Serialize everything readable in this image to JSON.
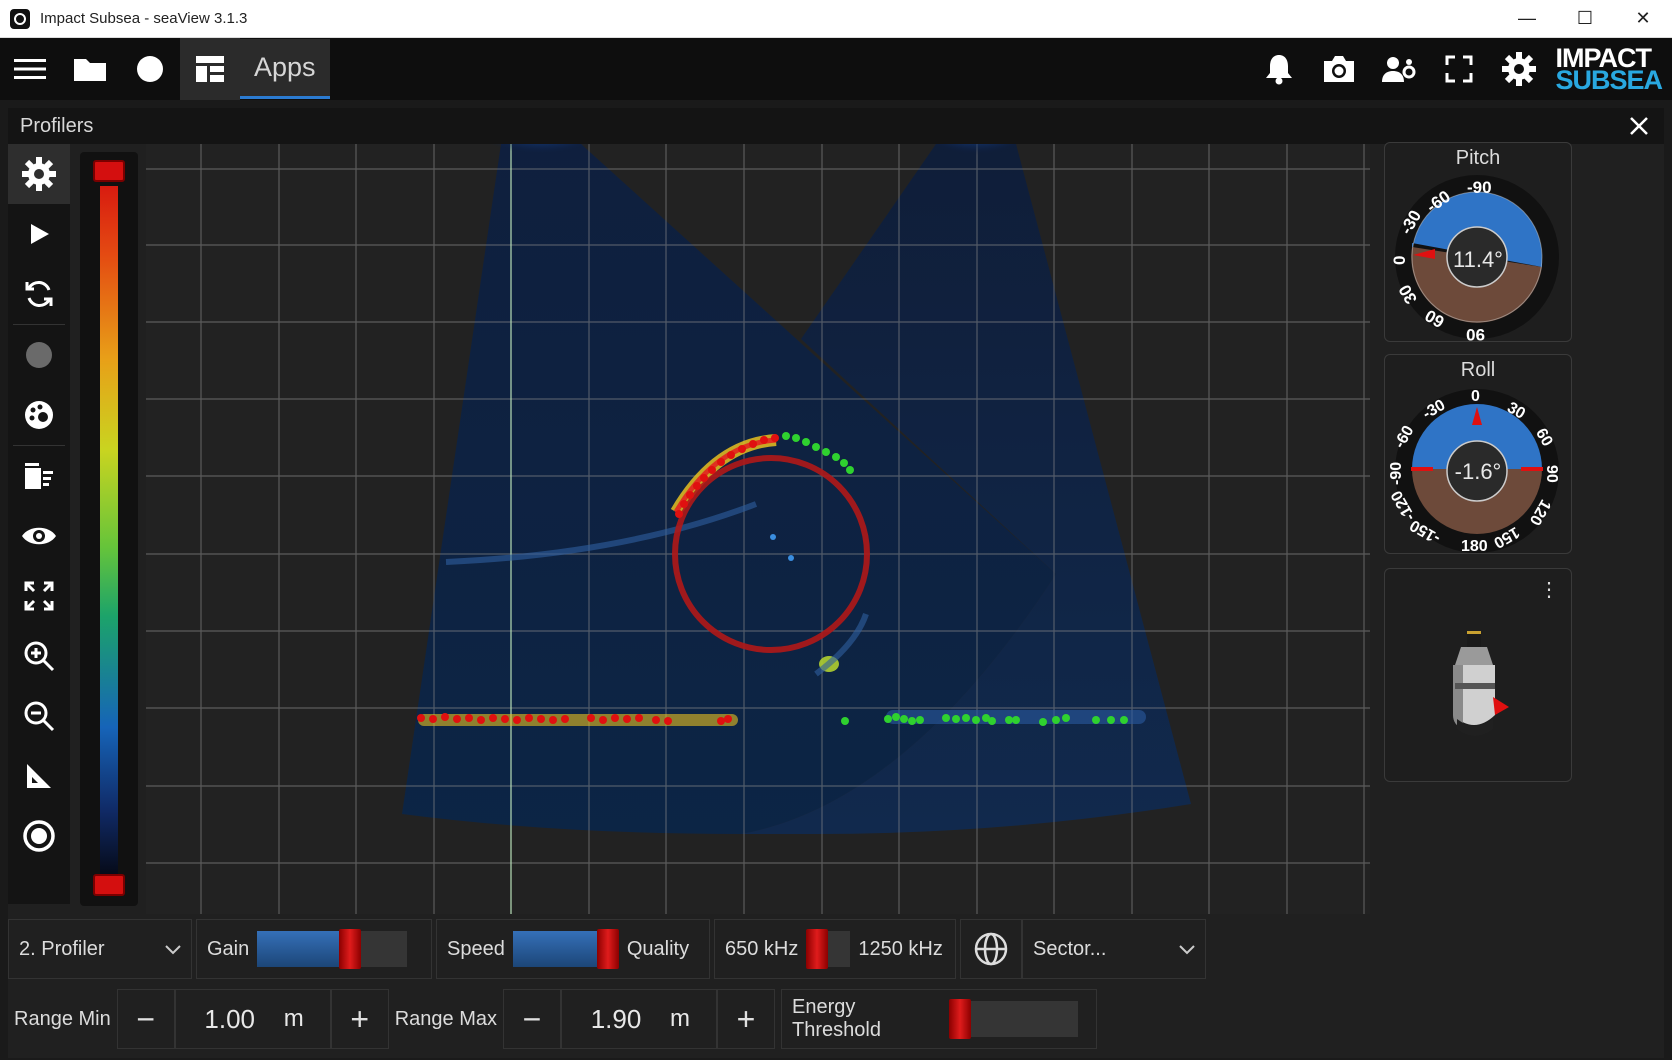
{
  "window": {
    "title": "Impact Subsea - seaView 3.1.3",
    "min": "—",
    "max": "☐",
    "close": "✕"
  },
  "toolbar": {
    "apps_label": "Apps",
    "logo_line1": "IMPACT",
    "logo_line2": "SUBSEA"
  },
  "panel": {
    "title": "Profilers"
  },
  "sidebar": {
    "items": [
      "settings-icon",
      "play-icon",
      "refresh-icon",
      "record-dot-icon",
      "palette-icon",
      "clear-icon",
      "eye-icon",
      "expand-icon",
      "zoom-in-icon",
      "zoom-out-icon",
      "measure-icon",
      "target-icon"
    ]
  },
  "pitch": {
    "label": "Pitch",
    "value": "11.4°",
    "ticks": [
      "-90",
      "-60",
      "-30",
      "0",
      "30",
      "60",
      "90"
    ]
  },
  "roll": {
    "label": "Roll",
    "value": "-1.6°",
    "ticks": [
      "0",
      "30",
      "60",
      "90",
      "120",
      "150",
      "180",
      "-150",
      "-120",
      "-90",
      "-60",
      "-30"
    ]
  },
  "model": {
    "menu": "⋮"
  },
  "controls": {
    "profiler_select": "2. Profiler",
    "gain_label": "Gain",
    "gain_level": 0.62,
    "speed_label": "Speed",
    "quality_label": "Quality",
    "speed_quality_level": 0.98,
    "freq_low": "650 kHz",
    "freq_high": "1250 kHz",
    "freq_level": 0.1,
    "mode_select": "Sector...",
    "range_min_label": "Range Min",
    "range_min_value": "1.00",
    "range_max_label": "Range Max",
    "range_max_value": "1.90",
    "unit": "m",
    "minus": "−",
    "plus": "+",
    "energy_label": "Energy Threshold",
    "energy_level": 0.05
  },
  "colors": {
    "accent": "#2b7bd1",
    "thumb": "#e01c1c",
    "detect_red": "#e01010",
    "detect_green": "#2fd12f"
  }
}
